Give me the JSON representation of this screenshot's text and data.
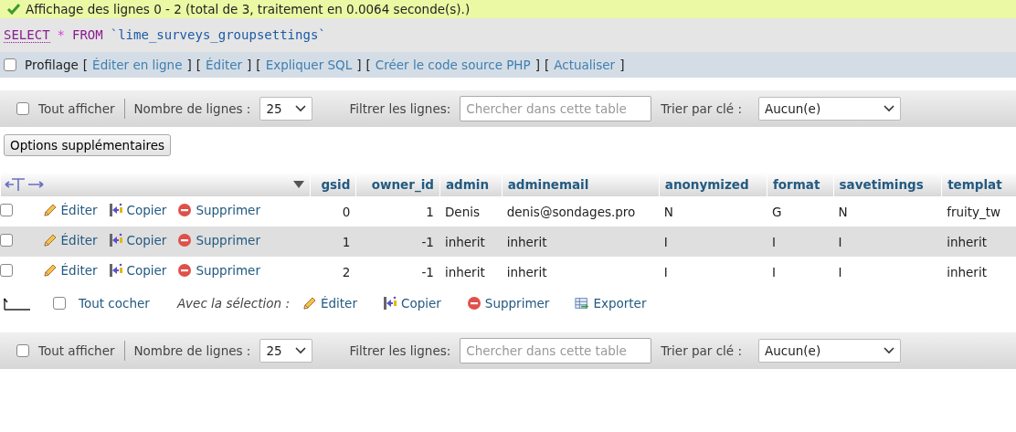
{
  "message": {
    "text": "Affichage des lignes 0 - 2 (total de 3, traitement en 0.0064 seconde(s).)"
  },
  "sql": {
    "keyword_select": "SELECT",
    "star": "*",
    "keyword_from": "FROM",
    "table": "`lime_surveys_groupsettings`"
  },
  "query_links": {
    "profiling": {
      "label": "Profilage",
      "checked": false
    },
    "open": "[",
    "close": "]",
    "links": [
      "Éditer en ligne",
      "Éditer",
      "Expliquer SQL",
      "Créer le code source PHP",
      "Actualiser"
    ]
  },
  "toolbars": [
    {
      "show_all": {
        "label": "Tout afficher",
        "checked": false
      },
      "rows_label": "Nombre de lignes :",
      "rows_value": "25",
      "filter_label": "Filtrer les lignes:",
      "filter_placeholder": "Chercher dans cette table",
      "sort_label": "Trier par clé :",
      "sort_value": "Aucun(e)"
    },
    {
      "show_all": {
        "label": "Tout afficher",
        "checked": false
      },
      "rows_label": "Nombre de lignes :",
      "rows_value": "25",
      "filter_label": "Filtrer les lignes:",
      "filter_placeholder": "Chercher dans cette table",
      "sort_label": "Trier par clé :",
      "sort_value": "Aucun(e)"
    }
  ],
  "extra_options_button": "Options supplémentaires",
  "table": {
    "columns": [
      {
        "label": "gsid",
        "numeric": true
      },
      {
        "label": "owner_id",
        "numeric": true
      },
      {
        "label": "admin",
        "numeric": false
      },
      {
        "label": "adminemail",
        "numeric": false
      },
      {
        "label": "anonymized",
        "numeric": false
      },
      {
        "label": "format",
        "numeric": false
      },
      {
        "label": "savetimings",
        "numeric": false
      },
      {
        "label": "templat",
        "numeric": false
      }
    ],
    "rows": [
      {
        "checked": false,
        "actions": [
          {
            "kind": "edit",
            "label": "Éditer"
          },
          {
            "kind": "copy",
            "label": "Copier"
          },
          {
            "kind": "delete",
            "label": "Supprimer"
          }
        ],
        "cells": [
          "0",
          "1",
          "Denis",
          "denis@sondages.pro",
          "N",
          "G",
          "N",
          "fruity_tw"
        ]
      },
      {
        "checked": false,
        "actions": [
          {
            "kind": "edit",
            "label": "Éditer"
          },
          {
            "kind": "copy",
            "label": "Copier"
          },
          {
            "kind": "delete",
            "label": "Supprimer"
          }
        ],
        "cells": [
          "1",
          "-1",
          "inherit",
          "inherit",
          "I",
          "I",
          "I",
          "inherit"
        ]
      },
      {
        "checked": false,
        "actions": [
          {
            "kind": "edit",
            "label": "Éditer"
          },
          {
            "kind": "copy",
            "label": "Copier"
          },
          {
            "kind": "delete",
            "label": "Supprimer"
          }
        ],
        "cells": [
          "2",
          "-1",
          "inherit",
          "inherit",
          "I",
          "I",
          "I",
          "inherit"
        ]
      }
    ]
  },
  "bulk": {
    "select_all": {
      "label": "Tout cocher",
      "checked": false
    },
    "with_selection": "Avec la sélection :",
    "actions": [
      {
        "kind": "edit",
        "label": "Éditer"
      },
      {
        "kind": "copy",
        "label": "Copier"
      },
      {
        "kind": "delete",
        "label": "Supprimer"
      },
      {
        "kind": "export",
        "label": "Exporter"
      }
    ]
  }
}
